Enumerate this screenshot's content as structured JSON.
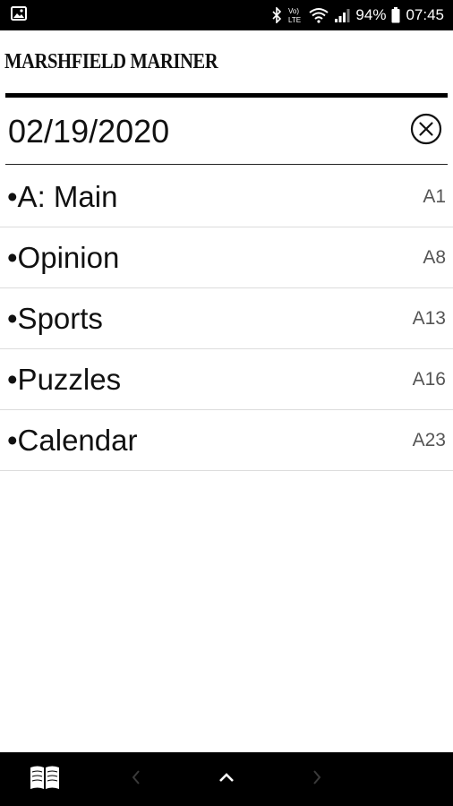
{
  "status_bar": {
    "battery": "94%",
    "time": "07:45",
    "network_label": "Vo) LTE",
    "icons": [
      "image-notification-icon",
      "bluetooth-icon",
      "volte-icon",
      "wifi-icon",
      "signal-icon",
      "battery-icon"
    ]
  },
  "masthead": {
    "title": "MARSHFIELD MARINER"
  },
  "edition": {
    "date": "02/19/2020",
    "clear_icon": "circle-x-icon"
  },
  "sections": [
    {
      "label": "•A: Main",
      "page": "A1"
    },
    {
      "label": "•Opinion",
      "page": "A8"
    },
    {
      "label": "•Sports",
      "page": "A13"
    },
    {
      "label": "•Puzzles",
      "page": "A16"
    },
    {
      "label": "•Calendar",
      "page": "A23"
    }
  ],
  "bottom_nav": {
    "icons": [
      "open-book-icon",
      "chevron-left-icon",
      "chevron-up-icon",
      "chevron-right-icon"
    ]
  },
  "colors": {
    "bar_background": "#000000",
    "text": "#111111",
    "page_number": "#555555",
    "divider": "#dcdcdc"
  }
}
